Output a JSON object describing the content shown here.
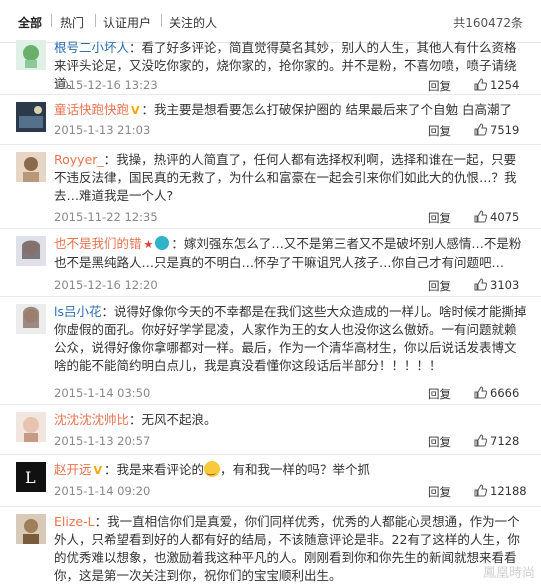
{
  "filter": {
    "tabs": [
      "全部",
      "热门",
      "认证用户",
      "关注的人"
    ],
    "count": "共160472条"
  },
  "comments": [
    {
      "user": "根号二小坏人",
      "text": "：看了好多评论，简直觉得莫名其妙，别人的人生，其他人有什么资格来评头论足，又没吃你家的，烧你家的，抢你家的。并不是粉，不喜勿喷，喷子请绕道。",
      "time": "2015-12-16 13:23",
      "reply": "回复",
      "likes": "1254"
    },
    {
      "user": "童话快跑快跑",
      "badge": "V",
      "text": "：我主要是想看要怎么打破保护圈的 结果最后来了个自勉 白高潮了",
      "time": "2015-1-13 21:03",
      "reply": "回复",
      "likes": "7519"
    },
    {
      "user": "Royyer_",
      "text": "：我操，热评的人简直了，任何人都有选择权利啊，选择和谁在一起，只要不违反法律，国民真的无救了，为什么和富豪在一起会引来你们如此大的仇恨…？我去…难道我是一个人?",
      "time": "2015-11-22 12:35",
      "reply": "回复",
      "likes": "4075"
    },
    {
      "user": "也不是我们的错",
      "badge": "★",
      "text": "：嫁刘强东怎么了…又不是第三者又不是破坏别人感情…不是粉也不是黑纯路人…只是真的不明白…怀孕了干嘛诅咒人孩子…你自己才有问题吧…",
      "time": "2015-12-16 12:20",
      "reply": "回复",
      "likes": "3103"
    },
    {
      "user": "ls吕小花",
      "text": "：说得好像你今天的不幸都是在我们这些大众造成的一样儿。啥时候才能撕掉你虚假的面孔。你好好学学昆凌，人家作为王的女人也没你这么傲娇。一有问题就赖公众，说得好像你拿哪都对一样。最后，作为一个清华高材生，你以后说话发表博文啥的能不能简约明白点儿，我是真没看懂你这段话后半部分！！！！！",
      "time": "2015-1-14 03:50",
      "reply": "回复",
      "likes": "6666"
    },
    {
      "user": "沈沈沈沈帅比",
      "text": "：无风不起浪。",
      "time": "2015-1-13 20:57",
      "reply": "回复",
      "likes": "7128"
    },
    {
      "user": "赵开远",
      "badge": "V",
      "text": "：我是来看评论的",
      "text2": "，有和我一样的吗？举个抓",
      "time": "2015-1-14 09:20",
      "reply": "回复",
      "likes": "12188"
    },
    {
      "user": "Elize-L",
      "text": "：我一直相信你们是真爱，你们同样优秀，优秀的人都能心灵想通，作为一个外人，只希望看到好的人都有好的结局，不该随意评论是非。22有了这样的人生，你的优秀难以想象，也激励着我这种平凡的人。刚刚看到你和你先生的新闻就想来看看你，这是第一次关注到你，祝你们的宝宝顺利出生。"
    }
  ],
  "watermark": "鳳凰時尚"
}
